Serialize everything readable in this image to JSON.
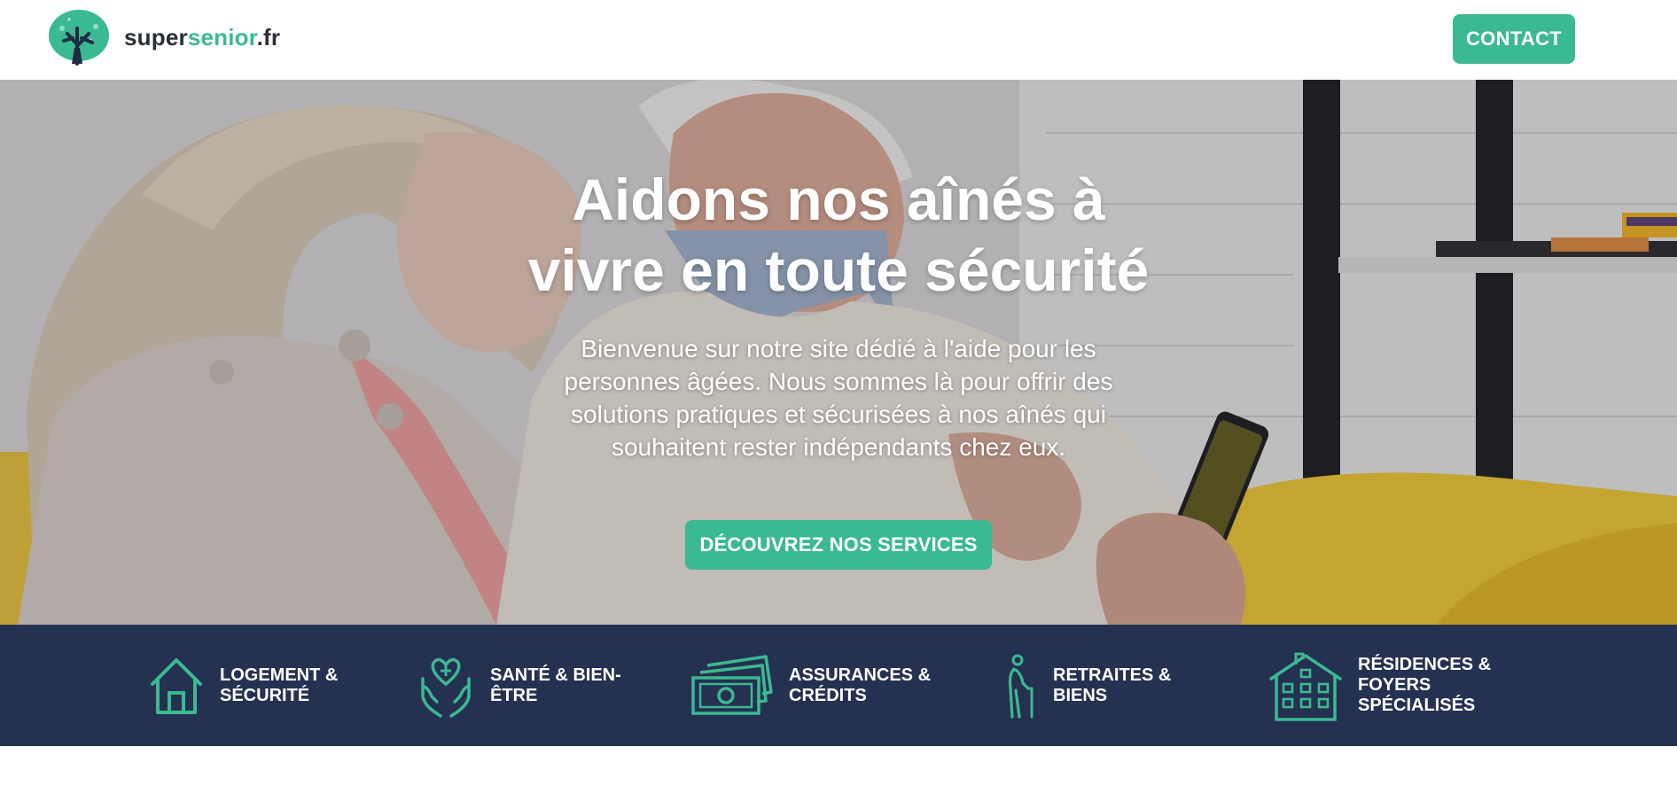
{
  "header": {
    "logo": {
      "part1": "super",
      "part2": "senior",
      "part3": ".fr"
    },
    "contact_label": "CONTACT"
  },
  "hero": {
    "title_line1": "Aidons nos aînés à",
    "title_line2": "vivre en toute sécurité",
    "intro_line1": "Bienvenue sur notre site dédié à l'aide pour les",
    "intro_line2": "personnes âgées. Nous sommes là pour offrir des",
    "intro_line3": "solutions pratiques et sécurisées à nos aînés qui",
    "intro_line4": "souhaitent rester indépendants chez eux.",
    "cta_label": "DÉCOUVREZ NOS SERVICES"
  },
  "services": [
    {
      "icon": "house-icon",
      "line1": "LOGEMENT &",
      "line2": "SÉCURITÉ",
      "line3": ""
    },
    {
      "icon": "heart-hands-icon",
      "line1": "SANTÉ & BIEN-",
      "line2": "ÊTRE",
      "line3": ""
    },
    {
      "icon": "money-icon",
      "line1": "ASSURANCES &",
      "line2": "CRÉDITS",
      "line3": ""
    },
    {
      "icon": "elderly-person-icon",
      "line1": "RETRAITES &",
      "line2": "BIENS",
      "line3": ""
    },
    {
      "icon": "building-icon",
      "line1": "RÉSIDENCES &",
      "line2": "FOYERS",
      "line3": "SPÉCIALISÉS"
    }
  ],
  "colors": {
    "accent": "#3bb993",
    "navy": "#253150",
    "text_dark": "#2b2f3a"
  }
}
